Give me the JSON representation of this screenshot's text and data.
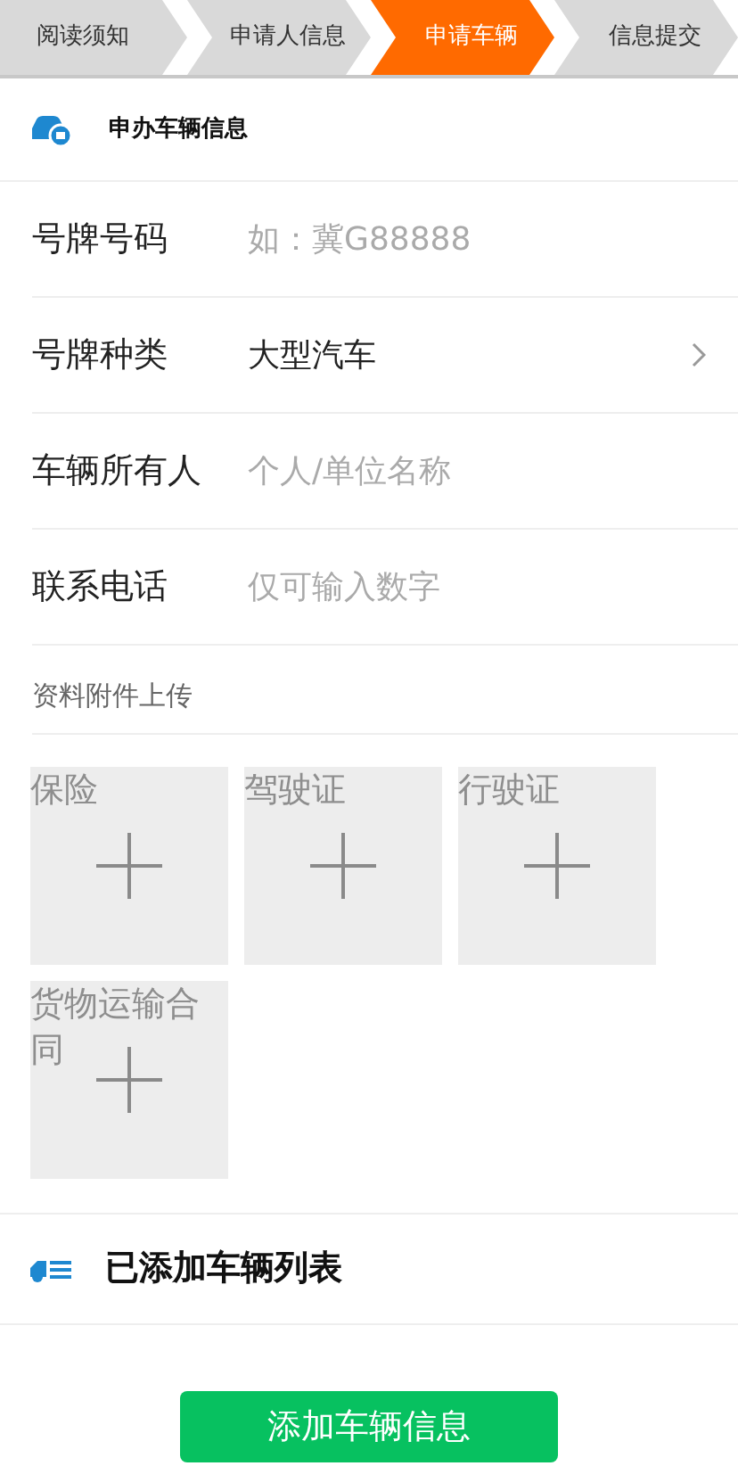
{
  "steps": [
    {
      "label": "阅读须知",
      "selected": false
    },
    {
      "label": "申请人信息",
      "selected": false
    },
    {
      "label": "申请车辆",
      "selected": true
    },
    {
      "label": "信息提交",
      "selected": false
    }
  ],
  "section_title": "申办车辆信息",
  "fields": [
    {
      "kind": "input",
      "label": "号牌号码",
      "placeholder": "如：冀G88888"
    },
    {
      "kind": "select",
      "label": "号牌种类",
      "value": "大型汽车"
    },
    {
      "kind": "input",
      "label": "车辆所有人",
      "placeholder": "个人/单位名称"
    },
    {
      "kind": "input",
      "label": "联系电话",
      "placeholder": "仅可输入数字"
    }
  ],
  "attachments": {
    "title": "资料附件上传",
    "items": [
      {
        "label": "保险"
      },
      {
        "label": "驾驶证"
      },
      {
        "label": "行驶证"
      },
      {
        "label": "货物运输合同"
      }
    ]
  },
  "vehicle_list": {
    "title": "已添加车辆列表"
  },
  "add_button": "添加车辆信息"
}
